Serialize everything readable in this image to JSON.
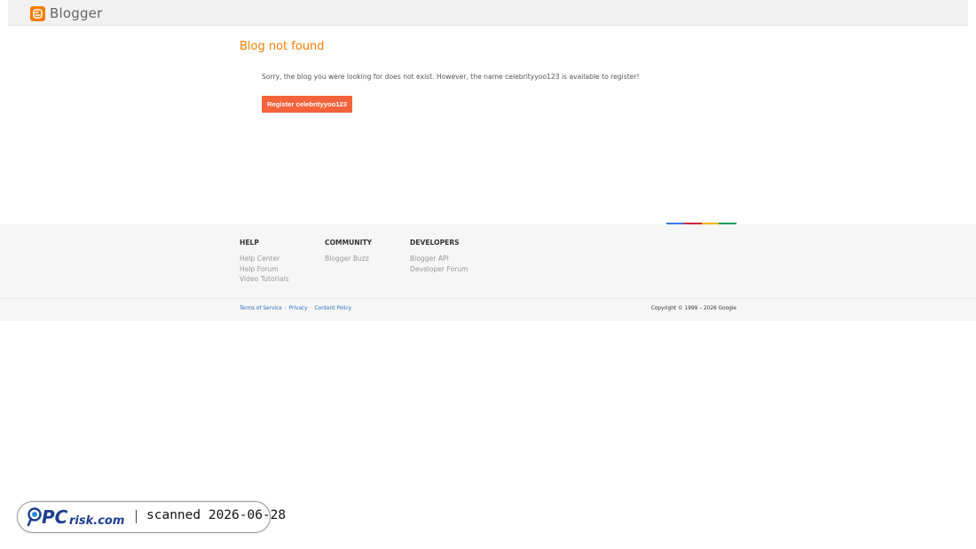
{
  "header": {
    "logo_text": "Blogger"
  },
  "main": {
    "title": "Blog not found",
    "message": "Sorry, the blog you were looking for does not exist. However, the name celebrityyoo123 is available to register!",
    "register_button": "Register celebrityyoo123"
  },
  "colorbar": [
    "#3b78e7",
    "#d0263c",
    "#f4b400",
    "#0f9d58"
  ],
  "footer": {
    "columns": [
      {
        "heading": "HELP",
        "links": [
          "Help Center",
          "Help Forum",
          "Video Tutorials"
        ]
      },
      {
        "heading": "COMMUNITY",
        "links": [
          "Blogger Buzz"
        ]
      },
      {
        "heading": "DEVELOPERS",
        "links": [
          "Blogger API",
          "Developer Forum"
        ]
      }
    ],
    "legal_links": [
      "Terms of Service",
      "Privacy",
      "Content Policy"
    ],
    "copyright": "Copyright © 1999 – 2026 Google"
  },
  "watermark": {
    "brand_text": "PCrisk.com",
    "scan_text": "scanned 2026-06-28"
  },
  "colors": {
    "brand_orange": "#f57d00",
    "button_orange": "#f4633b",
    "link_blue": "#2a6ebb"
  }
}
